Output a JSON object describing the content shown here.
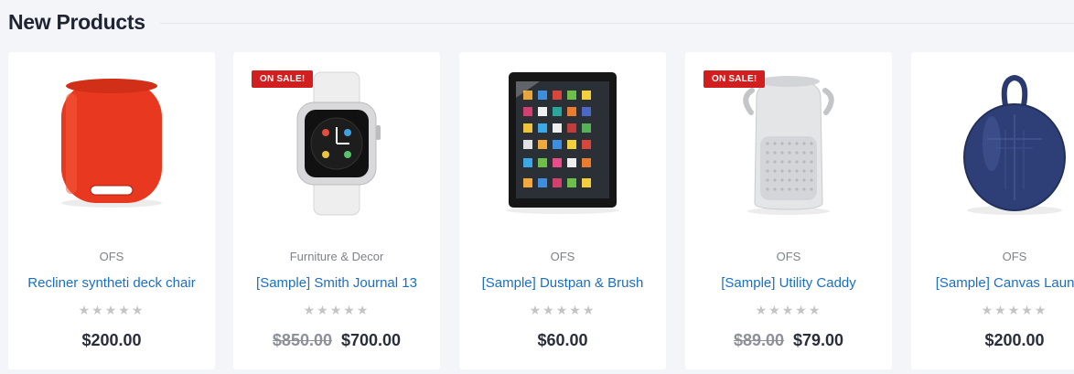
{
  "section": {
    "title": "New Products"
  },
  "products": [
    {
      "badge": "",
      "brand": "OFS",
      "name": "Recliner syntheti deck chair",
      "old_price": "",
      "price": "$200.00",
      "rating": 0,
      "image": "red-speaker"
    },
    {
      "badge": "ON SALE!",
      "brand": "Furniture & Decor",
      "name": "[Sample] Smith Journal 13",
      "old_price": "$850.00",
      "price": "$700.00",
      "rating": 0,
      "image": "smartwatch"
    },
    {
      "badge": "",
      "brand": "OFS",
      "name": "[Sample] Dustpan & Brush",
      "old_price": "",
      "price": "$60.00",
      "rating": 0,
      "image": "tablet"
    },
    {
      "badge": "ON SALE!",
      "brand": "OFS",
      "name": "[Sample] Utility Caddy",
      "old_price": "$89.00",
      "price": "$79.00",
      "rating": 0,
      "image": "silver-speaker"
    },
    {
      "badge": "",
      "brand": "OFS",
      "name": "[Sample] Canvas Laundry",
      "old_price": "",
      "price": "$200.00",
      "rating": 0,
      "image": "blue-speaker"
    }
  ],
  "stars_text": "★★★★★",
  "colors": {
    "link": "#1a6fc4",
    "badge": "#d11f1f",
    "title": "#1f2433"
  }
}
